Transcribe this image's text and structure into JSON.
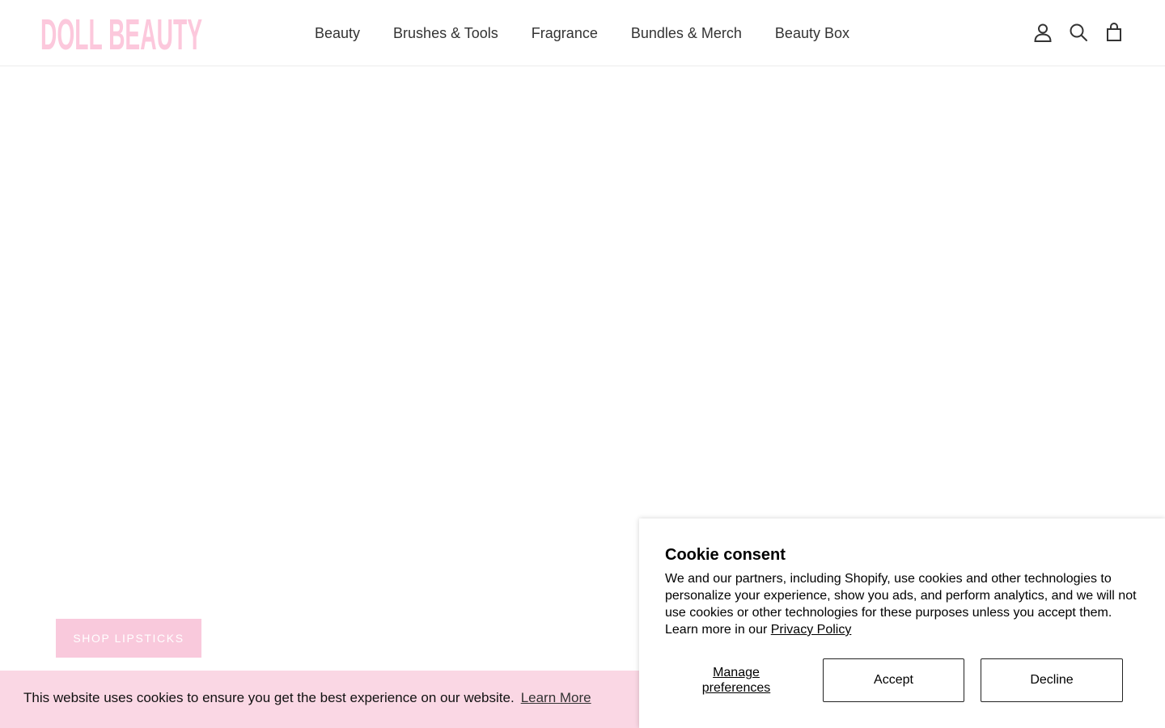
{
  "header": {
    "logo_text": "DOLL BEAUTY",
    "nav": [
      {
        "label": "Beauty"
      },
      {
        "label": "Brushes & Tools"
      },
      {
        "label": "Fragrance"
      },
      {
        "label": "Bundles & Merch"
      },
      {
        "label": "Beauty Box"
      }
    ],
    "icons": [
      "account-icon",
      "search-icon",
      "cart-icon"
    ]
  },
  "hero": {
    "cta_label": "SHOP LIPSTICKS"
  },
  "cookie_bar": {
    "text": "This website uses cookies to ensure you get the best experience on our website.",
    "link_label": "Learn More"
  },
  "consent": {
    "title": "Cookie consent",
    "body": "We and our partners, including Shopify, use cookies and other technologies to personalize your experience, show you ads, and perform analytics, and we will not use cookies or other technologies for these purposes unless you accept them. Learn more in our",
    "policy_link": "Privacy Policy",
    "manage_label": "Manage preferences",
    "accept_label": "Accept",
    "decline_label": "Decline"
  },
  "colors": {
    "brand_pink": "#fcc8dc",
    "button_pink": "#f9c9dc",
    "cookie_bar_bg": "#fad7e4",
    "button_text": "#ffffff"
  }
}
